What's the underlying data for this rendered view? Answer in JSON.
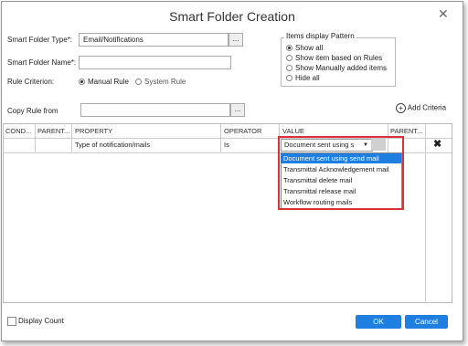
{
  "dialog": {
    "title": "Smart Folder Creation",
    "close_label": "✕"
  },
  "form": {
    "type_label": "Smart Folder Type*:",
    "type_value": "Email/Notifications",
    "ellipsis": "...",
    "name_label": "Smart Folder Name*:",
    "name_value": "",
    "criterion_label": "Rule Criterion:",
    "criterion_options": [
      "Manual Rule",
      "System Rule"
    ],
    "criterion_selected": "Manual Rule",
    "copy_label": "Copy Rule from",
    "copy_value": "",
    "add_criteria": "Add Criteria"
  },
  "pattern": {
    "legend": "Items display Pattern",
    "options": [
      "Show all",
      "Show item based on Rules",
      "Show Manually added items",
      "Hide all"
    ],
    "selected": "Show all"
  },
  "grid": {
    "headers": [
      "COND...",
      "PARENT...",
      "PROPERTY",
      "OPERATOR",
      "VALUE",
      "PARENT..."
    ],
    "row": {
      "property": "Type of notification/mails",
      "operator": "Is",
      "value": "Document sent using s"
    },
    "dropdown_options": [
      "Document sent using send mail",
      "Transmittal Acknowledgement mail",
      "Transmittal delete mail",
      "Transmittal release mail",
      "Workflow routing mails"
    ],
    "highlighted": "Document sent using send mail"
  },
  "footer": {
    "display_count": "Display Count",
    "ok": "OK",
    "cancel": "Cancel"
  },
  "colors": {
    "accent": "#1e7fe0",
    "highlight_border": "#d9323a"
  }
}
